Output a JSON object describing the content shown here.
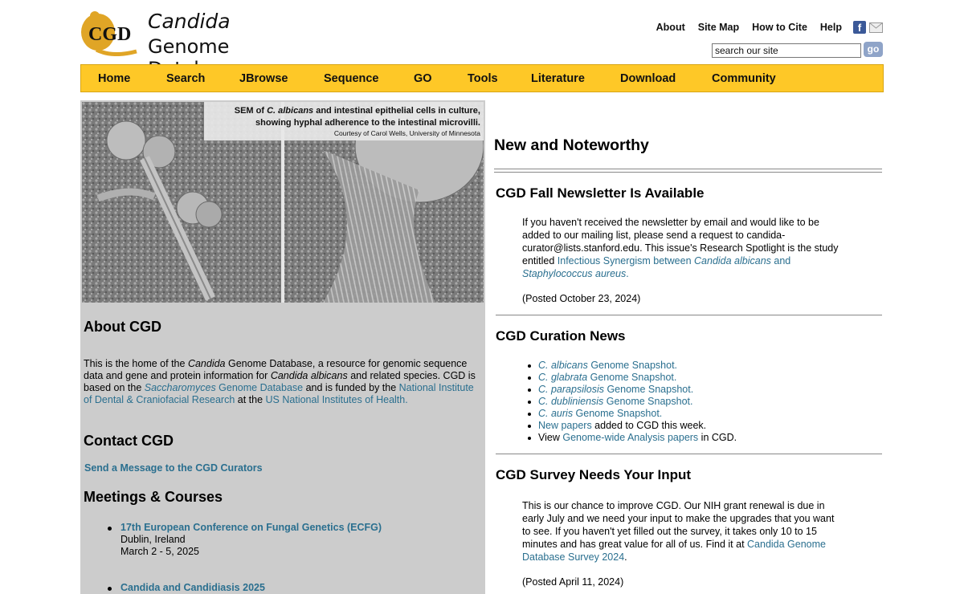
{
  "header": {
    "logo_text": "CGD",
    "title_line1": "Candida",
    "title_line2": "Genome Database",
    "top_links": [
      "About",
      "Site Map",
      "How to Cite",
      "Help"
    ],
    "facebook_glyph": "f",
    "search_placeholder": "search our site",
    "search_button": "go"
  },
  "nav": [
    "Home",
    "Search",
    "JBrowse",
    "Sequence",
    "GO",
    "Tools",
    "Literature",
    "Download",
    "Community"
  ],
  "hero": {
    "caption_pre": "SEM of ",
    "caption_species": "C. albicans",
    "caption_rest": " and intestinal epithelial cells in culture,",
    "caption_line2": "showing hyphal adherence to the intestinal microvilli.",
    "credit": "Courtesy of Carol Wells, University of Minnesota"
  },
  "about": {
    "heading": "About CGD",
    "t1": "This is the home of the ",
    "t1_it": "Candida",
    "t2": " Genome Database, a resource for genomic sequence data and gene and protein information for ",
    "t2_it": "Candida albicans",
    "t3": " and related species. CGD is based on the ",
    "link1_it": "Saccharomyces",
    "link1": " Genome Database",
    "t4": " and is funded by the ",
    "link2": "National Institute of Dental & Craniofacial Research",
    "t5": " at the ",
    "link3": "US National Institutes of Health",
    "t6": "."
  },
  "contact": {
    "heading": "Contact CGD",
    "link": "Send a Message to the CGD Curators"
  },
  "meetings": {
    "heading": "Meetings & Courses",
    "items": [
      {
        "title": "17th European Conference on Fungal Genetics (ECFG)",
        "place": "Dublin, Ireland",
        "date": "March 2 - 5, 2025"
      },
      {
        "title": "Candida and Candidiasis 2025"
      }
    ]
  },
  "news": {
    "heading": "New and Noteworthy",
    "newsletter": {
      "title": "CGD Fall Newsletter Is Available",
      "text": "If you haven't received the newsletter by email and would like to be added to our mailing list, please send a request to candida-curator@lists.stanford.edu. This issue's Research Spotlight is the study entitled ",
      "link_a": "Infectious Synergism between ",
      "link_it1": "Candida albicans",
      "link_b": " and ",
      "link_it2": "Staphylococcus aureus",
      "link_c": ".",
      "posted": "(Posted October 23, 2024)"
    },
    "curation": {
      "title": "CGD Curation News",
      "snapshots": [
        {
          "species": "C. albicans",
          "label": " Genome Snapshot."
        },
        {
          "species": "C. glabrata",
          "label": " Genome Snapshot."
        },
        {
          "species": "C. parapsilosis",
          "label": " Genome Snapshot."
        },
        {
          "species": "C. dubliniensis",
          "label": " Genome Snapshot."
        },
        {
          "species": "C. auris",
          "label": " Genome Snapshot."
        }
      ],
      "new_papers_link": "New papers",
      "new_papers_text": " added to CGD this week.",
      "view_text": "View ",
      "gwa_link": "Genome-wide Analysis papers",
      "gwa_text": " in CGD."
    },
    "survey": {
      "title": "CGD Survey Needs Your Input",
      "text": "This is our chance to improve CGD. Our NIH grant renewal is due in early July and we need your input to make the upgrades that you want to see. If you haven't yet filled out the survey, it takes only 10 to 15 minutes and has great value for all of us. Find it at ",
      "link": "Candida Genome Database Survey 2024",
      "after": ".",
      "posted": "(Posted April 11, 2024)"
    }
  },
  "colors": {
    "nav_bg": "#fec827",
    "link": "#2a6f8f",
    "sidebar_bg": "#cccccc",
    "logo_gold": "#e0a526"
  }
}
